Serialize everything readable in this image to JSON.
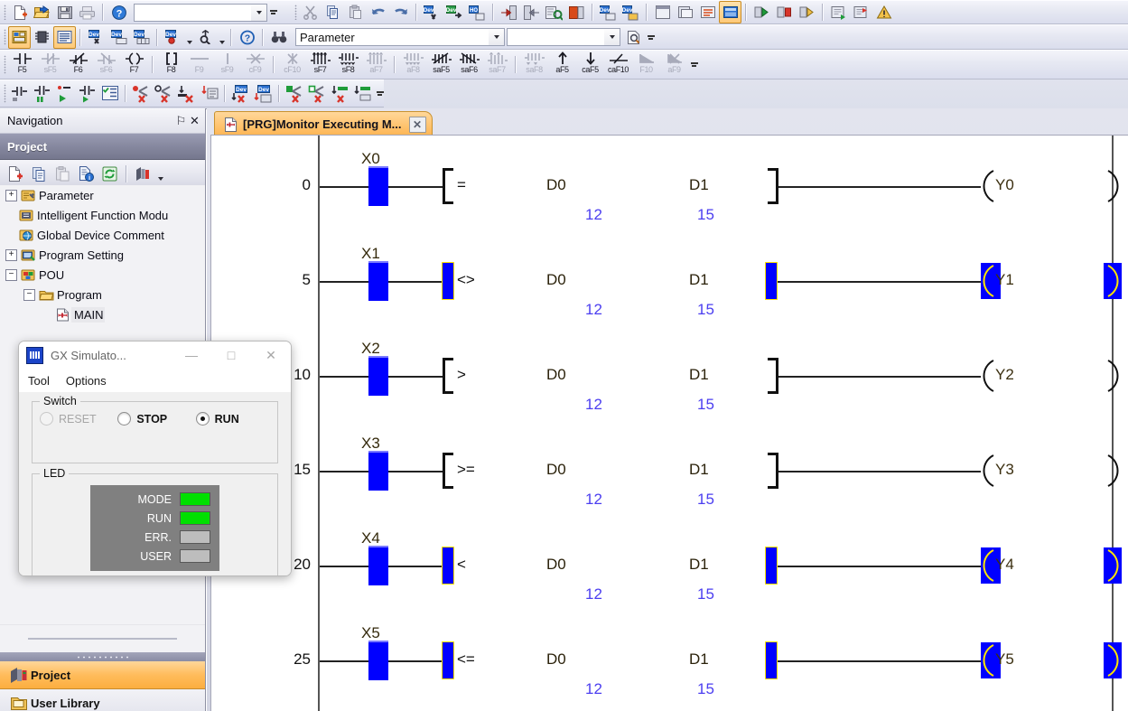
{
  "window": {
    "tab_title": "[PRG]Monitor Executing M...",
    "tab_close": "✕"
  },
  "toolbars": {
    "combo_parameter": {
      "value": "Parameter",
      "placeholder": ""
    },
    "combo_secondary": {
      "value": "",
      "placeholder": ""
    },
    "ladder_keys_row": [
      {
        "key": "F5",
        "enabled": true,
        "name": "open-contact"
      },
      {
        "key": "sF5",
        "enabled": false,
        "name": "closed-contact"
      },
      {
        "key": "F6",
        "enabled": true,
        "name": "open-branch"
      },
      {
        "key": "sF6",
        "enabled": false,
        "name": "closed-branch"
      },
      {
        "key": "F7",
        "enabled": true,
        "name": "coil"
      },
      {
        "key": "F8",
        "enabled": true,
        "name": "application-instruction"
      },
      {
        "key": "F9",
        "enabled": false,
        "name": "horizontal-line"
      },
      {
        "key": "sF9",
        "enabled": false,
        "name": "vertical-line"
      },
      {
        "key": "cF9",
        "enabled": false,
        "name": "delete-horizontal-line"
      },
      {
        "key": "cF10",
        "enabled": false,
        "name": "delete-vertical-line"
      },
      {
        "key": "sF7",
        "enabled": true,
        "name": "rising-pulse"
      },
      {
        "key": "sF8",
        "enabled": true,
        "name": "falling-pulse"
      },
      {
        "key": "aF7",
        "enabled": false,
        "name": "rising-pulse-branch"
      },
      {
        "key": "aF8",
        "enabled": false,
        "name": "falling-pulse-branch"
      },
      {
        "key": "saF5",
        "enabled": true,
        "name": "invert-pulse"
      },
      {
        "key": "saF6",
        "enabled": true,
        "name": "invert-operation-results"
      },
      {
        "key": "saF7",
        "enabled": false,
        "name": "rising-pulse-branch-alt"
      },
      {
        "key": "saF8",
        "enabled": false,
        "name": "falling-pulse-branch-alt"
      },
      {
        "key": "aF5",
        "enabled": true,
        "name": "up-arrow"
      },
      {
        "key": "caF5",
        "enabled": true,
        "name": "down-arrow"
      },
      {
        "key": "caF10",
        "enabled": true,
        "name": "invert-line"
      },
      {
        "key": "F10",
        "enabled": false,
        "name": "label-line"
      },
      {
        "key": "aF9",
        "enabled": false,
        "name": "delete-label-line"
      }
    ]
  },
  "navigation": {
    "title": "Navigation",
    "pin_icon": "⚐",
    "close_icon": "✕",
    "section_title": "Project",
    "tree": [
      {
        "label": "Parameter",
        "depth": 0,
        "expander": "+",
        "icon": "parameter-icon"
      },
      {
        "label": "Intelligent Function Modu",
        "depth": 0,
        "expander": "",
        "icon": "intelligent-module-icon"
      },
      {
        "label": "Global Device Comment",
        "depth": 0,
        "expander": "",
        "icon": "global-comment-icon"
      },
      {
        "label": "Program Setting",
        "depth": 0,
        "expander": "+",
        "icon": "program-setting-icon"
      },
      {
        "label": "POU",
        "depth": 0,
        "expander": "−",
        "icon": "pou-icon"
      },
      {
        "label": "Program",
        "depth": 1,
        "expander": "−",
        "icon": "folder-icon"
      },
      {
        "label": "MAIN",
        "depth": 2,
        "expander": "",
        "icon": "ladder-file-icon",
        "selected": true
      }
    ],
    "bottom_items": [
      {
        "label": "Project",
        "active": true,
        "icon": "project-icon"
      },
      {
        "label": "User Library",
        "active": false,
        "icon": "library-icon"
      }
    ]
  },
  "simulator_dialog": {
    "title": "GX Simulato...",
    "minimize": "—",
    "maximize": "□",
    "close": "✕",
    "menu": [
      "Tool",
      "Options"
    ],
    "switch_group_label": "Switch",
    "switch_options": [
      {
        "label": "RESET",
        "selected": false,
        "enabled": false
      },
      {
        "label": "STOP",
        "selected": false,
        "enabled": true
      },
      {
        "label": "RUN",
        "selected": true,
        "enabled": true
      }
    ],
    "led_group_label": "LED",
    "leds": [
      {
        "label": "MODE",
        "state": "on",
        "color": "#00e000"
      },
      {
        "label": "RUN",
        "state": "on",
        "color": "#00e000"
      },
      {
        "label": "ERR.",
        "state": "off",
        "color": "#bdbdbd"
      },
      {
        "label": "USER",
        "state": "off",
        "color": "#bdbdbd"
      }
    ]
  },
  "ladder": {
    "colors": {
      "power_on": "#0000ff",
      "highlight_outline": "#ffe400",
      "value_text": "#4b3ef0",
      "device_text": "#3b2f10",
      "wire": "#222222"
    },
    "rungs": [
      {
        "step": "0",
        "input_device": "X0",
        "input_on": true,
        "operator": "=",
        "operator_on": false,
        "operand1": "D0",
        "value1": "12",
        "operand2": "D1",
        "value2": "15",
        "coil": "Y0",
        "coil_on": false
      },
      {
        "step": "5",
        "input_device": "X1",
        "input_on": true,
        "operator": "<>",
        "operator_on": true,
        "operand1": "D0",
        "value1": "12",
        "operand2": "D1",
        "value2": "15",
        "coil": "Y1",
        "coil_on": true
      },
      {
        "step": "10",
        "input_device": "X2",
        "input_on": true,
        "operator": ">",
        "operator_on": false,
        "operand1": "D0",
        "value1": "12",
        "operand2": "D1",
        "value2": "15",
        "coil": "Y2",
        "coil_on": false
      },
      {
        "step": "15",
        "input_device": "X3",
        "input_on": true,
        "operator": ">=",
        "operator_on": false,
        "operand1": "D0",
        "value1": "12",
        "operand2": "D1",
        "value2": "15",
        "coil": "Y3",
        "coil_on": false
      },
      {
        "step": "20",
        "input_device": "X4",
        "input_on": true,
        "operator": "<",
        "operator_on": true,
        "operand1": "D0",
        "value1": "12",
        "operand2": "D1",
        "value2": "15",
        "coil": "Y4",
        "coil_on": true
      },
      {
        "step": "25",
        "input_device": "X5",
        "input_on": true,
        "operator": "<=",
        "operator_on": true,
        "operand1": "D0",
        "value1": "12",
        "operand2": "D1",
        "value2": "15",
        "coil": "Y5",
        "coil_on": true
      }
    ]
  }
}
